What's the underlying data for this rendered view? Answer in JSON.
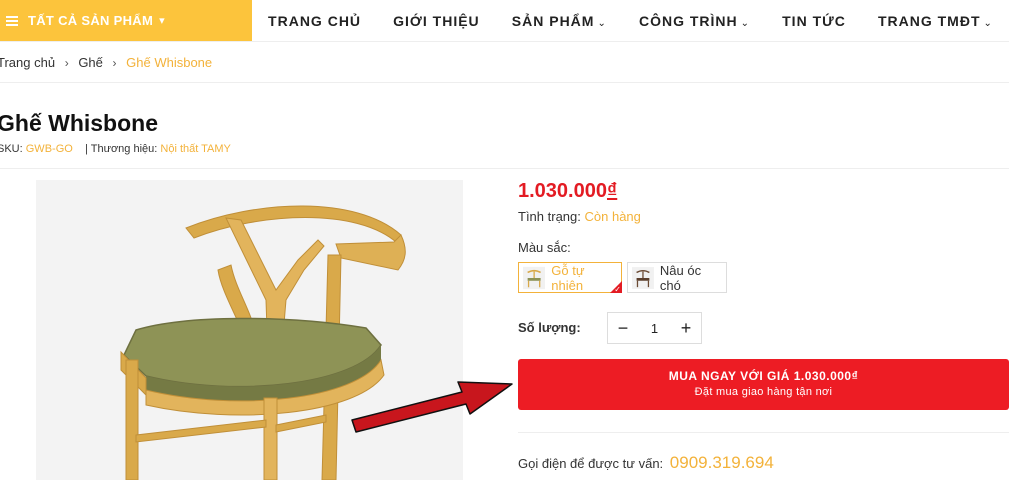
{
  "header": {
    "all_categories_label": "TẤT CẢ SẢN PHẨM",
    "nav": [
      {
        "label": "TRANG CHỦ",
        "has_dropdown": false
      },
      {
        "label": "GIỚI THIỆU",
        "has_dropdown": false
      },
      {
        "label": "SẢN PHẨM",
        "has_dropdown": true
      },
      {
        "label": "CÔNG TRÌNH",
        "has_dropdown": true
      },
      {
        "label": "TIN TỨC",
        "has_dropdown": false
      },
      {
        "label": "TRANG TMĐT",
        "has_dropdown": true
      }
    ]
  },
  "breadcrumb": [
    "Trang chủ",
    "Ghế",
    "Ghế Whisbone"
  ],
  "product": {
    "title": "Ghế Whisbone",
    "sku_label": "SKU:",
    "sku": "GWB-GO",
    "brand_label": "| Thương hiệu:",
    "brand": "Nội thất TAMY",
    "price": "1.030.000",
    "currency": "₫",
    "status_label": "Tình trạng:",
    "status": "Còn hàng",
    "color_label": "Màu sắc:",
    "colors": [
      {
        "name": "Gỗ tự nhiên",
        "selected": true
      },
      {
        "name": "Nâu óc chó",
        "selected": false
      }
    ],
    "qty_label": "Số lượng:",
    "qty": "1",
    "qty_minus": "−",
    "qty_plus": "+",
    "buy_line1": "MUA NGAY VỚI GIÁ 1.030.000₫",
    "buy_line2": "Đặt mua giao hàng tận nơi",
    "call_label": "Gọi điện để được tư vấn:",
    "phone": "0909.319.694"
  },
  "colors": {
    "accent": "#fcc43c",
    "accent_text": "#f3b23a",
    "price": "#e31b23",
    "buy_button": "#ed1c24",
    "annotation_arrow": "#c8161d"
  },
  "icons": [
    "menu-icon",
    "chevron-down-icon",
    "chevron-right-icon",
    "minus-icon",
    "plus-icon",
    "check-icon",
    "annotation-arrow"
  ]
}
